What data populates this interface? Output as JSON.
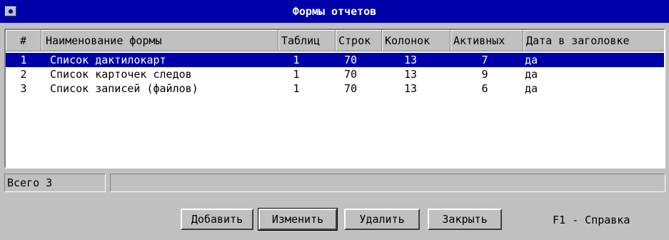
{
  "window": {
    "title": "Формы отчетов"
  },
  "table": {
    "columns": [
      "#",
      "Наименование формы",
      "Таблиц",
      "Строк",
      "Колонок",
      "Активных",
      "Дата в заголовке"
    ],
    "rows": [
      {
        "num": "1",
        "name": "Список дактилокарт",
        "tables": "1",
        "rows": "70",
        "cols": "13",
        "active": "7",
        "date": "да"
      },
      {
        "num": "2",
        "name": "Список карточек следов",
        "tables": "1",
        "rows": "70",
        "cols": "13",
        "active": "9",
        "date": "да"
      },
      {
        "num": "3",
        "name": "Список записей (файлов)",
        "tables": "1",
        "rows": "70",
        "cols": "13",
        "active": "6",
        "date": "да"
      }
    ],
    "selected_row": 0
  },
  "status": {
    "total": "Всего 3"
  },
  "buttons": {
    "add": "Добавить",
    "edit": "Изменить",
    "delete": "Удалить",
    "close": "Закрыть"
  },
  "help_text": "F1 - Справка",
  "colors": {
    "titlebar": "#0000aa",
    "selection": "#0000aa",
    "face": "#c0c0c0"
  }
}
